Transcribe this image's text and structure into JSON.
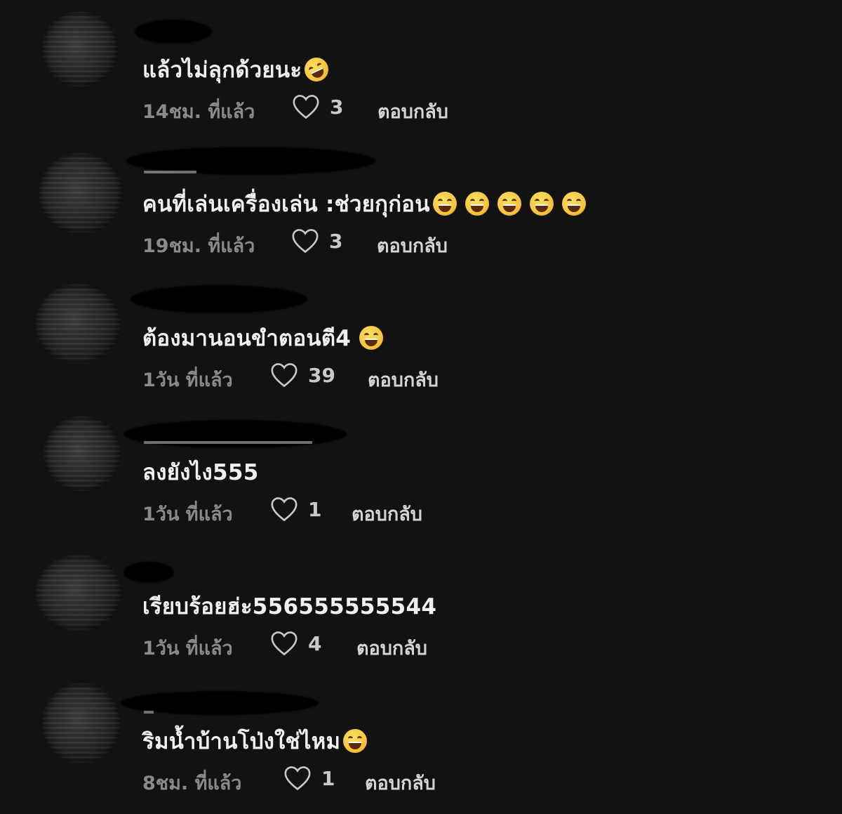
{
  "comments": [
    {
      "text": "แล้วไม่ลุกด้วยนะ",
      "emoji": [
        "rolling-on-floor-laughing"
      ],
      "time": "14ชม. ที่แล้ว",
      "likes": "3",
      "reply": "ตอบกลับ"
    },
    {
      "text": "คนที่เล่นเครื่องเล่น :ช่วยกุก่อน",
      "emoji": [
        "grinning-squinting",
        "grinning-squinting",
        "grinning-squinting",
        "grinning-squinting",
        "grinning-squinting"
      ],
      "time": "19ชม. ที่แล้ว",
      "likes": "3",
      "reply": "ตอบกลับ"
    },
    {
      "text": "ต้องมานอนขำตอนตี4",
      "emoji": [
        "grinning-squinting"
      ],
      "time": "1วัน ที่แล้ว",
      "likes": "39",
      "reply": "ตอบกลับ"
    },
    {
      "text": "ลงยังไง555",
      "emoji": [],
      "time": "1วัน ที่แล้ว",
      "likes": "1",
      "reply": "ตอบกลับ"
    },
    {
      "text": "เรียบร้อยฮ่ะ556555555544",
      "emoji": [],
      "time": "1วัน ที่แล้ว",
      "likes": "4",
      "reply": "ตอบกลับ"
    },
    {
      "text": "ริมน้ำบ้านโป่งใช่ไหม",
      "emoji": [
        "grinning-squinting"
      ],
      "time": "8ชม. ที่แล้ว",
      "likes": "1",
      "reply": "ตอบกลับ"
    }
  ],
  "icons": {
    "like": "heart-outline-icon",
    "avatar": "redacted-avatar"
  },
  "colors": {
    "background": "#121212",
    "text": "#f0f0f0",
    "meta": "#8a8a8a"
  }
}
